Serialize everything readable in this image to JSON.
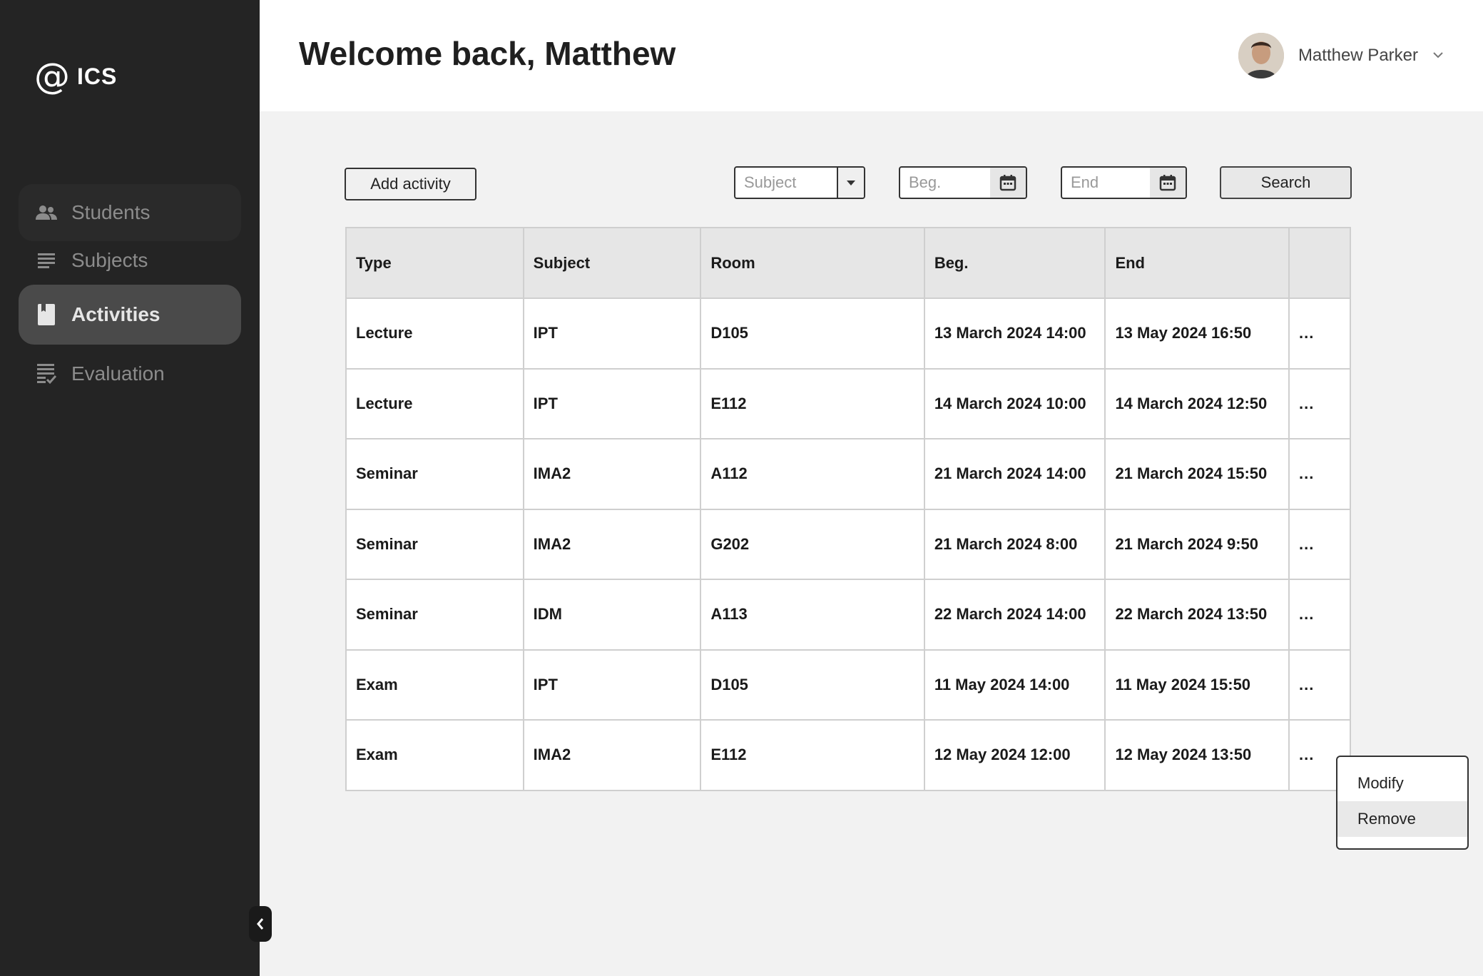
{
  "app": {
    "logo_symbol": "@",
    "logo_text": "ICS"
  },
  "sidebar": {
    "items": [
      {
        "label": "Students",
        "icon": "people-icon"
      },
      {
        "label": "Subjects",
        "icon": "lines-icon"
      },
      {
        "label": "Activities",
        "icon": "book-icon",
        "active": true
      },
      {
        "label": "Evaluation",
        "icon": "checklist-icon"
      }
    ]
  },
  "header": {
    "welcome": "Welcome back, Matthew",
    "user_name": "Matthew Parker"
  },
  "toolbar": {
    "add_label": "Add activity",
    "subject_placeholder": "Subject",
    "beg_placeholder": "Beg.",
    "end_placeholder": "End",
    "search_label": "Search"
  },
  "table": {
    "columns": [
      "Type",
      "Subject",
      "Room",
      "Beg.",
      "End",
      ""
    ],
    "rows": [
      [
        "Lecture",
        "IPT",
        "D105",
        "13 March 2024 14:00",
        "13 May 2024 16:50",
        "..."
      ],
      [
        "Lecture",
        "IPT",
        "E112",
        "14 March 2024 10:00",
        "14 March 2024 12:50",
        "..."
      ],
      [
        "Seminar",
        "IMA2",
        "A112",
        "21 March 2024 14:00",
        "21 March 2024 15:50",
        "..."
      ],
      [
        "Seminar",
        "IMA2",
        "G202",
        "21 March 2024 8:00",
        "21 March 2024 9:50",
        "..."
      ],
      [
        "Seminar",
        "IDM",
        "A113",
        "22 March 2024 14:00",
        "22 March 2024 13:50",
        "..."
      ],
      [
        "Exam",
        "IPT",
        "D105",
        "11 May 2024 14:00",
        "11 May 2024 15:50",
        "..."
      ],
      [
        "Exam",
        "IMA2",
        "E112",
        "12 May 2024 12:00",
        "12 May 2024 13:50",
        "..."
      ]
    ]
  },
  "context_menu": {
    "items": [
      "Modify",
      "Remove"
    ]
  },
  "colors": {
    "sidebar_bg": "#242424",
    "active_item": "#4a4a4a",
    "content_bg": "#f2f2f2"
  }
}
